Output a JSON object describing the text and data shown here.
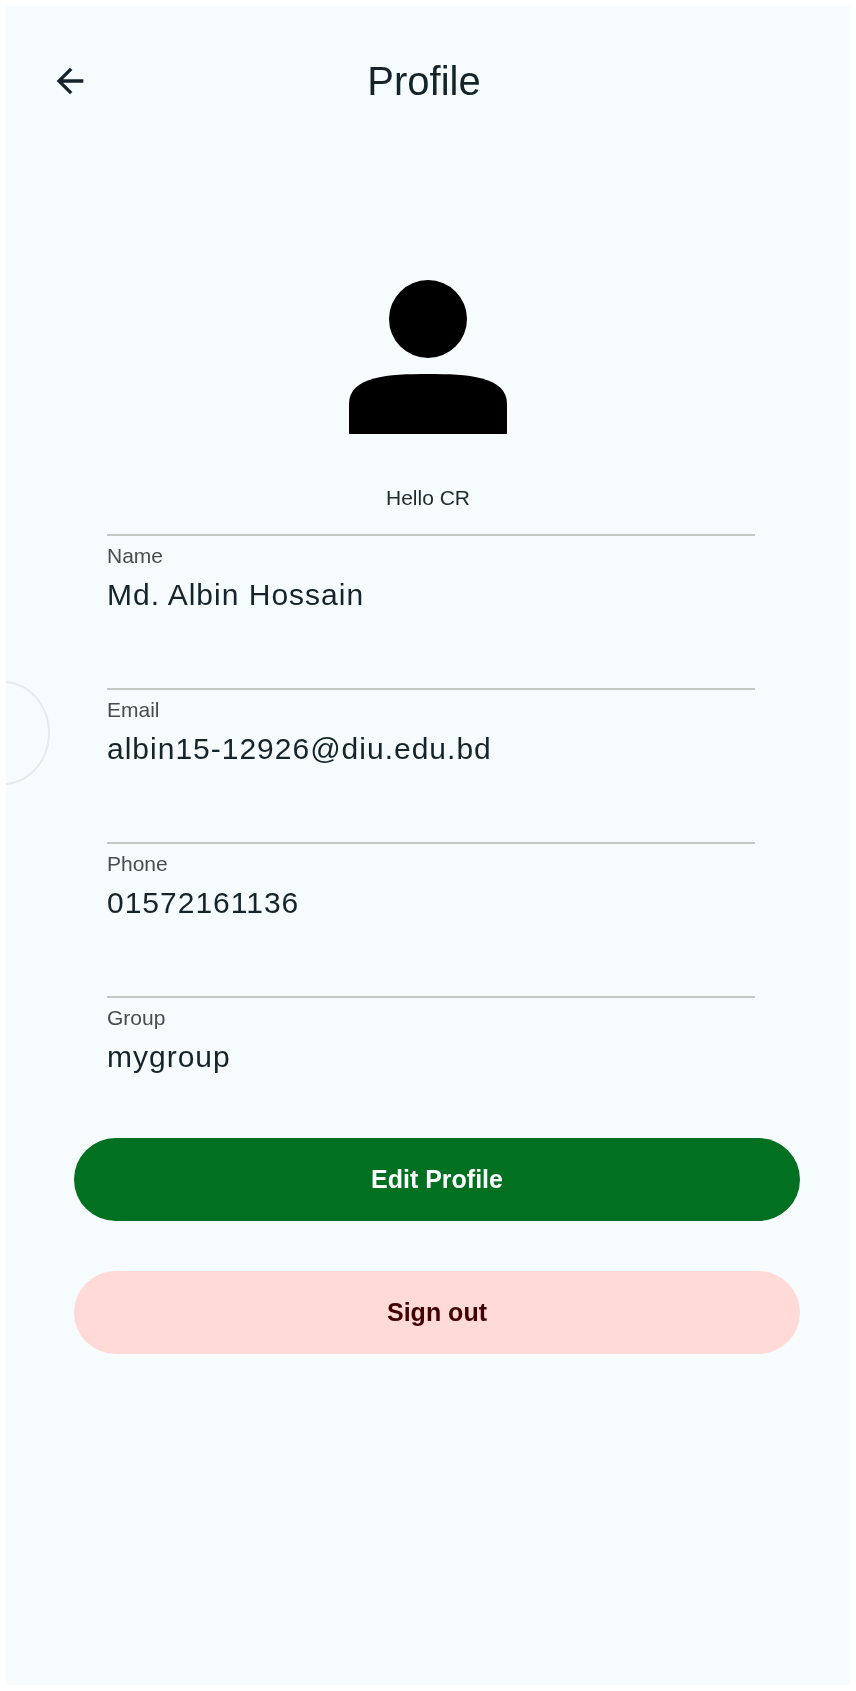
{
  "header": {
    "title": "Profile"
  },
  "greeting": "Hello CR",
  "fields": [
    {
      "label": "Name",
      "value": "Md. Albin Hossain"
    },
    {
      "label": "Email",
      "value": "albin15-12926@diu.edu.bd"
    },
    {
      "label": "Phone",
      "value": "01572161136"
    },
    {
      "label": "Group",
      "value": "mygroup"
    }
  ],
  "buttons": [
    {
      "kind": "primary",
      "label": "Edit Profile"
    },
    {
      "kind": "danger",
      "label": "Sign out"
    }
  ]
}
